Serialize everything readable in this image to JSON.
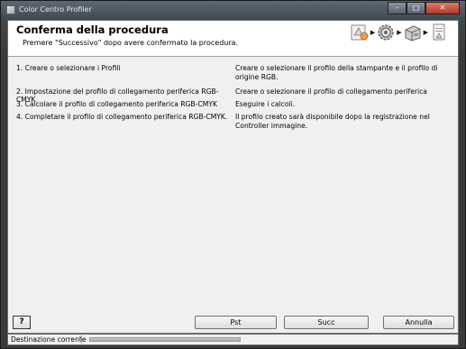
{
  "window": {
    "title": "Color Centro Profiler"
  },
  "header": {
    "title": "Conferma della procedura",
    "subtitle": "Premere \"Successivo\" dopo avere confermato la procedura."
  },
  "steps": [
    "target-icon",
    "gear-icon",
    "printer-icon",
    "document-icon"
  ],
  "procedure": [
    {
      "step": "1. Creare o selezionare i Profili",
      "description": "Creare o selezionare il profilo della stampante e il profilo di origine RGB."
    },
    {
      "step": "2. Impostazione del profilo di collegamento periferica RGB-CMYK",
      "description": "Creare o selezionare il profilo di collegamento periferica"
    },
    {
      "step": "3. Calcolare il profilo di collegamento periferica RGB-CMYK",
      "description": "Eseguire i calcoli."
    },
    {
      "step": "4. Completare il profilo di collegamento periferica RGB-CMYK.",
      "description": "Il profilo creato sarà disponibile dopo la registrazione nel Controller immagine."
    }
  ],
  "footer": {
    "help": "?",
    "prev": "Pst",
    "next": "Succ",
    "cancel": "Annulla"
  },
  "status": {
    "label": "Destinazione corrente"
  }
}
